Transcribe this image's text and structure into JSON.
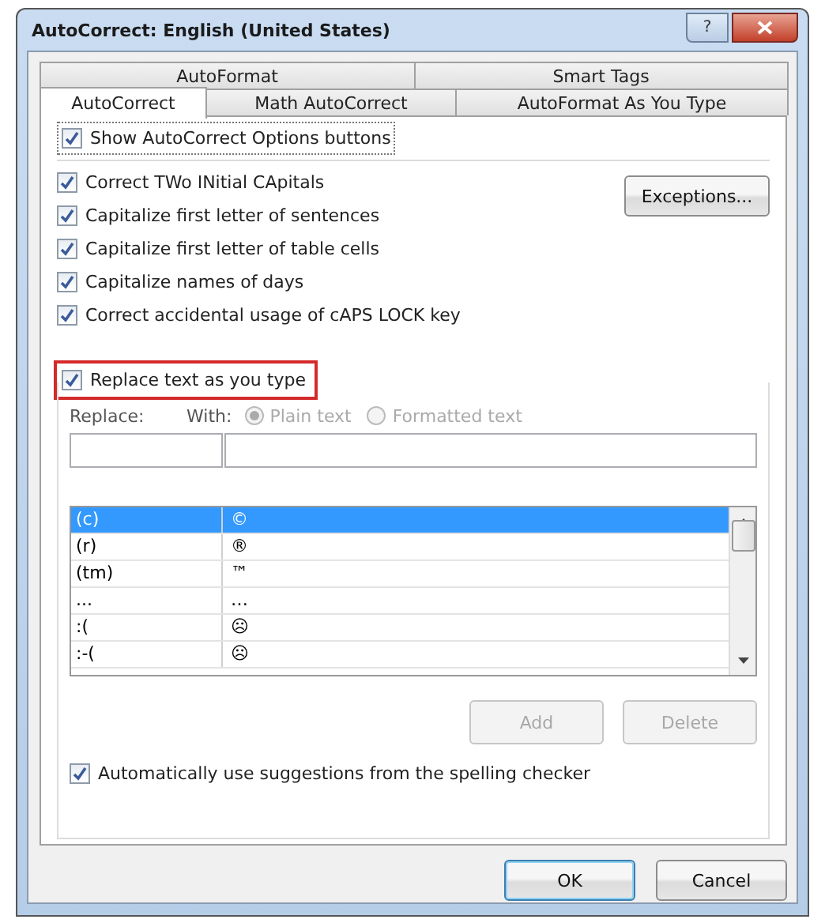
{
  "window": {
    "title": "AutoCorrect: English (United States)",
    "help_icon": "?"
  },
  "tabs": [
    [
      {
        "label": "AutoFormat",
        "selected": false
      },
      {
        "label": "Smart Tags",
        "selected": false
      }
    ],
    [
      {
        "label": "AutoCorrect",
        "selected": true
      },
      {
        "label": "Math AutoCorrect",
        "selected": false
      },
      {
        "label": "AutoFormat As You Type",
        "selected": false
      }
    ]
  ],
  "show_options": {
    "label": "Show AutoCorrect Options buttons",
    "checked": true
  },
  "options": [
    {
      "label": "Correct TWo INitial CApitals",
      "checked": true
    },
    {
      "label": "Capitalize first letter of sentences",
      "checked": true
    },
    {
      "label": "Capitalize first letter of table cells",
      "checked": true
    },
    {
      "label": "Capitalize names of days",
      "checked": true
    },
    {
      "label": "Correct accidental usage of cAPS LOCK key",
      "checked": true
    }
  ],
  "exceptions_button": "Exceptions...",
  "replace_text": {
    "label": "Replace text as you type",
    "checked": true,
    "highlighted": true
  },
  "replace_label": "Replace:",
  "with_label": "With:",
  "format_options": [
    {
      "label": "Plain text",
      "selected": true,
      "disabled": true
    },
    {
      "label": "Formatted text",
      "selected": false,
      "disabled": true
    }
  ],
  "entries": [
    {
      "replace": "(c)",
      "with": "©",
      "selected": true
    },
    {
      "replace": "(r)",
      "with": "®",
      "selected": false
    },
    {
      "replace": "(tm)",
      "with": "™",
      "selected": false
    },
    {
      "replace": "...",
      "with": "…",
      "selected": false
    },
    {
      "replace": ":(",
      "with": "☹",
      "selected": false
    },
    {
      "replace": ":-(",
      "with": "☹",
      "selected": false
    }
  ],
  "list_buttons": [
    {
      "label": "Add",
      "disabled": true
    },
    {
      "label": "Delete",
      "disabled": true
    }
  ],
  "auto_suggest": {
    "label": "Automatically use suggestions from the spelling checker",
    "checked": true
  },
  "buttons": [
    {
      "label": "OK",
      "default": true
    },
    {
      "label": "Cancel",
      "default": false
    }
  ]
}
